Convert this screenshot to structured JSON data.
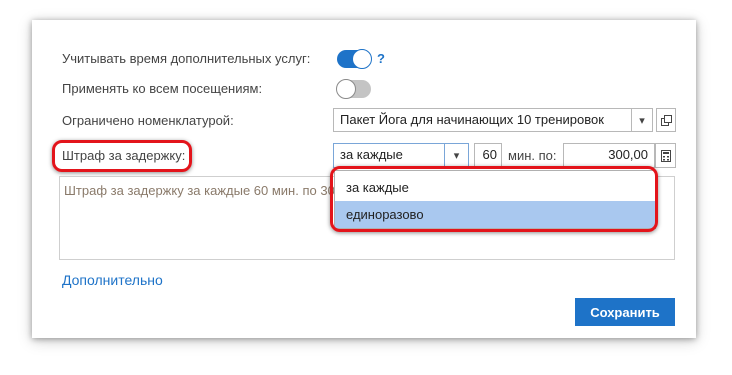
{
  "form": {
    "account_service_time_label": "Учитывать время дополнительных услуг:",
    "account_service_time_on": true,
    "help_mark": "?",
    "apply_all_visits_label": "Применять ко всем посещениям:",
    "apply_all_visits_on": false,
    "nomenclature_label": "Ограничено номенклатурой:",
    "nomenclature_value": "Пакет Йога для начинающих 10 тренировок",
    "penalty_label": "Штраф за задержку:",
    "penalty_mode_value": "за каждые",
    "penalty_minutes": "60",
    "minutes_unit_label": "мин.  по:",
    "penalty_amount": "300,00",
    "summary_text": "Штраф за задержку  за каждые 60 мин. по 300,00",
    "dropdown_options": [
      "за каждые",
      "единоразово"
    ],
    "selected_option_index": 1,
    "more_link": "Дополнительно",
    "save_button": "Сохранить"
  },
  "colors": {
    "accent": "#1e73c8",
    "highlight_border": "#e3141b",
    "option_selected": "#a9c8ef"
  }
}
